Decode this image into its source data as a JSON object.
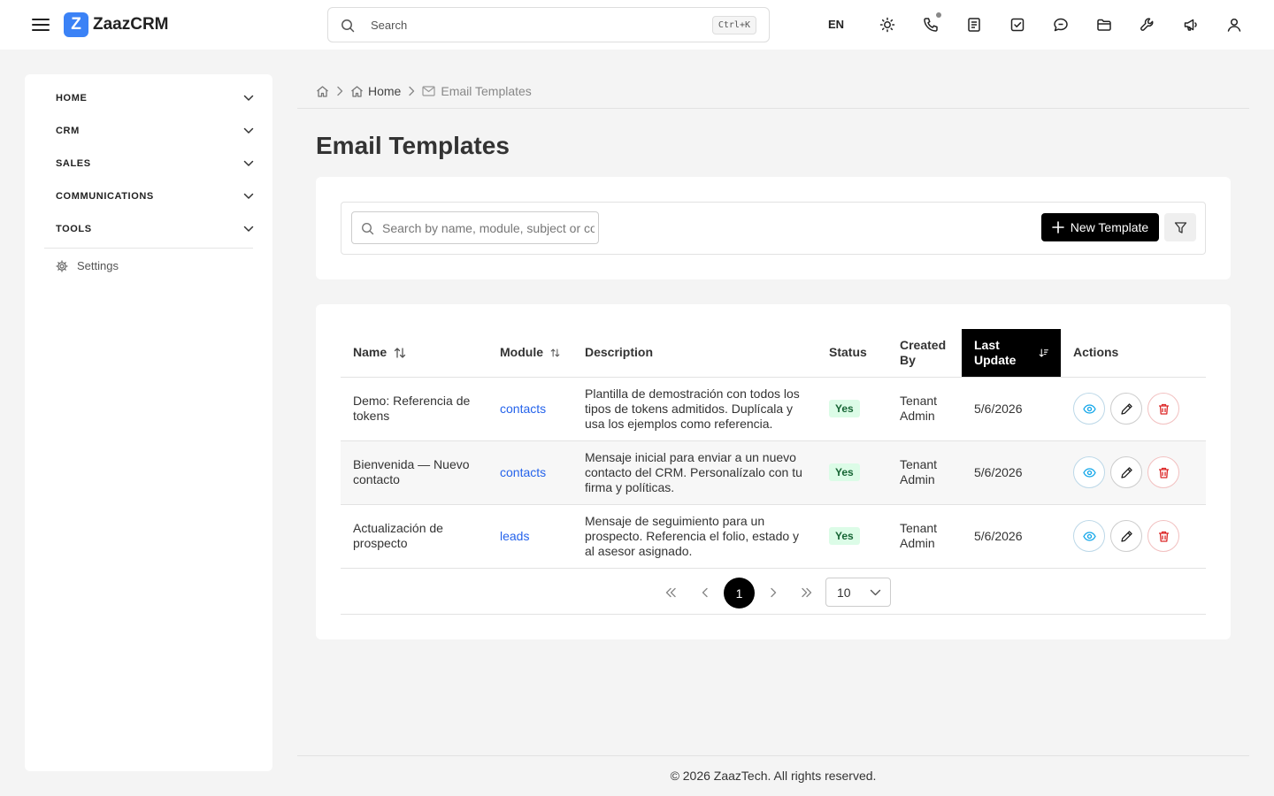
{
  "app": {
    "logo_letter": "Z",
    "name": "ZaazCRM",
    "brand_color": "#3b82f6"
  },
  "header": {
    "search_placeholder": "Search",
    "search_shortcut": "Ctrl+K",
    "language": "EN",
    "icons": [
      "menu-icon",
      "sun-icon",
      "phone-icon",
      "notes-icon",
      "tasks-icon",
      "chat-icon",
      "folder-icon",
      "wrench-icon",
      "megaphone-icon",
      "user-icon"
    ]
  },
  "sidebar": {
    "items": [
      {
        "label": "HOME"
      },
      {
        "label": "CRM"
      },
      {
        "label": "SALES"
      },
      {
        "label": "COMMUNICATIONS"
      },
      {
        "label": "TOOLS"
      }
    ],
    "settings_label": "Settings"
  },
  "breadcrumb": {
    "home": "Home",
    "current": "Email Templates"
  },
  "page": {
    "title": "Email Templates"
  },
  "toolbar": {
    "search_placeholder": "Search by name, module, subject or content",
    "new_button": "New Template"
  },
  "table": {
    "columns": {
      "name": "Name",
      "module": "Module",
      "description": "Description",
      "status": "Status",
      "created_by": "Created By",
      "last_update": "Last Update",
      "actions": "Actions"
    },
    "sorted_column": "Last Update",
    "rows": [
      {
        "name": "Demo: Referencia de tokens",
        "module": "contacts",
        "description": "Plantilla de demostración con todos los tipos de tokens admitidos. Duplícala y usa los ejemplos como referencia.",
        "status": "Yes",
        "created_by": "Tenant Admin",
        "last_update": "5/6/2026"
      },
      {
        "name": "Bienvenida — Nuevo contacto",
        "module": "contacts",
        "description": "Mensaje inicial para enviar a un nuevo contacto del CRM. Personalízalo con tu firma y políticas.",
        "status": "Yes",
        "created_by": "Tenant Admin",
        "last_update": "5/6/2026"
      },
      {
        "name": "Actualización de prospecto",
        "module": "leads",
        "description": "Mensaje de seguimiento para un prospecto. Referencia el folio, estado y al asesor asignado.",
        "status": "Yes",
        "created_by": "Tenant Admin",
        "last_update": "5/6/2026"
      }
    ]
  },
  "pagination": {
    "current_page": "1",
    "page_size": "10"
  },
  "footer": {
    "text": "© 2026 ZaazTech. All rights reserved."
  },
  "colors": {
    "status_yes_bg": "#dcfce7",
    "status_yes_text": "#166534",
    "link": "#2563eb",
    "view_action": "#0ea5e9",
    "delete_action": "#dc2626"
  }
}
